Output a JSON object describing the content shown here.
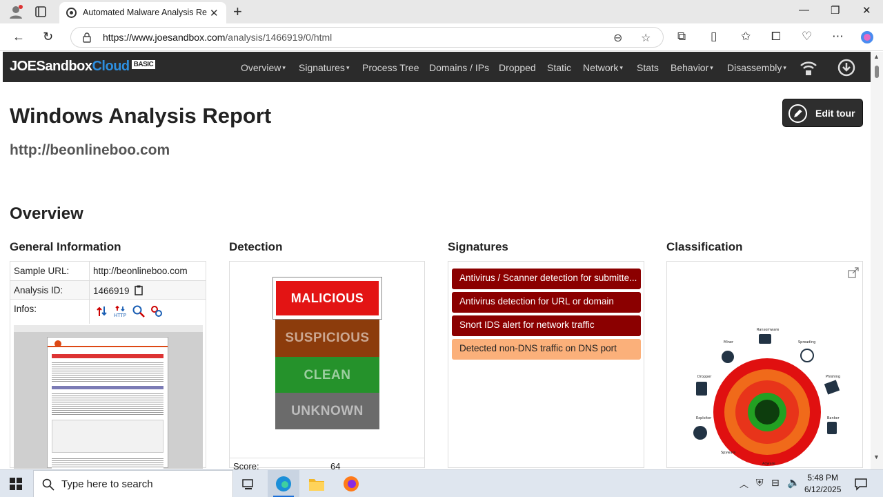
{
  "browser": {
    "tab_title": "Automated Malware Analysis Rep",
    "url_host": "https://www.joesandbox.com",
    "url_path": "/analysis/1466919/0/html"
  },
  "site": {
    "logo_main": "JOESandbox",
    "logo_cloud": "Cloud",
    "logo_badge": "BASIC",
    "menu": [
      "Overview",
      "Signatures",
      "Process Tree",
      "Domains / IPs",
      "Dropped",
      "Static",
      "Network",
      "Stats",
      "Behavior",
      "Disassembly"
    ]
  },
  "page": {
    "title": "Windows Analysis Report",
    "subject_url": "http://beonlineboo.com",
    "edit_tour": "Edit tour",
    "overview": "Overview"
  },
  "sections": {
    "general": "General Information",
    "detection": "Detection",
    "signatures": "Signatures",
    "classification": "Classification"
  },
  "general_info": {
    "sample_url_label": "Sample URL:",
    "sample_url": "http://beonlineboo.com",
    "analysis_id_label": "Analysis ID:",
    "analysis_id": "1466919",
    "infos_label": "Infos:"
  },
  "detection": {
    "levels": [
      "MALICIOUS",
      "SUSPICIOUS",
      "CLEAN",
      "UNKNOWN"
    ],
    "score_label": "Score:",
    "score": "64"
  },
  "signatures": [
    {
      "text": "Antivirus / Scanner detection for submitte...",
      "color": "#8b0000"
    },
    {
      "text": "Antivirus detection for URL or domain",
      "color": "#8b0000"
    },
    {
      "text": "Snort IDS alert for network traffic",
      "color": "#8b0000"
    },
    {
      "text": "Detected non-DNS traffic on DNS port",
      "color": "#fbb07a"
    }
  ],
  "classification_labels": [
    "Ransomware",
    "Miner",
    "Spreading",
    "Dropper",
    "Phishing",
    "Banker",
    "Exploiter",
    "Spyware",
    "Adware"
  ],
  "taskbar": {
    "search_placeholder": "Type here to search",
    "time": "5:48 PM",
    "date": "6/12/2025"
  }
}
